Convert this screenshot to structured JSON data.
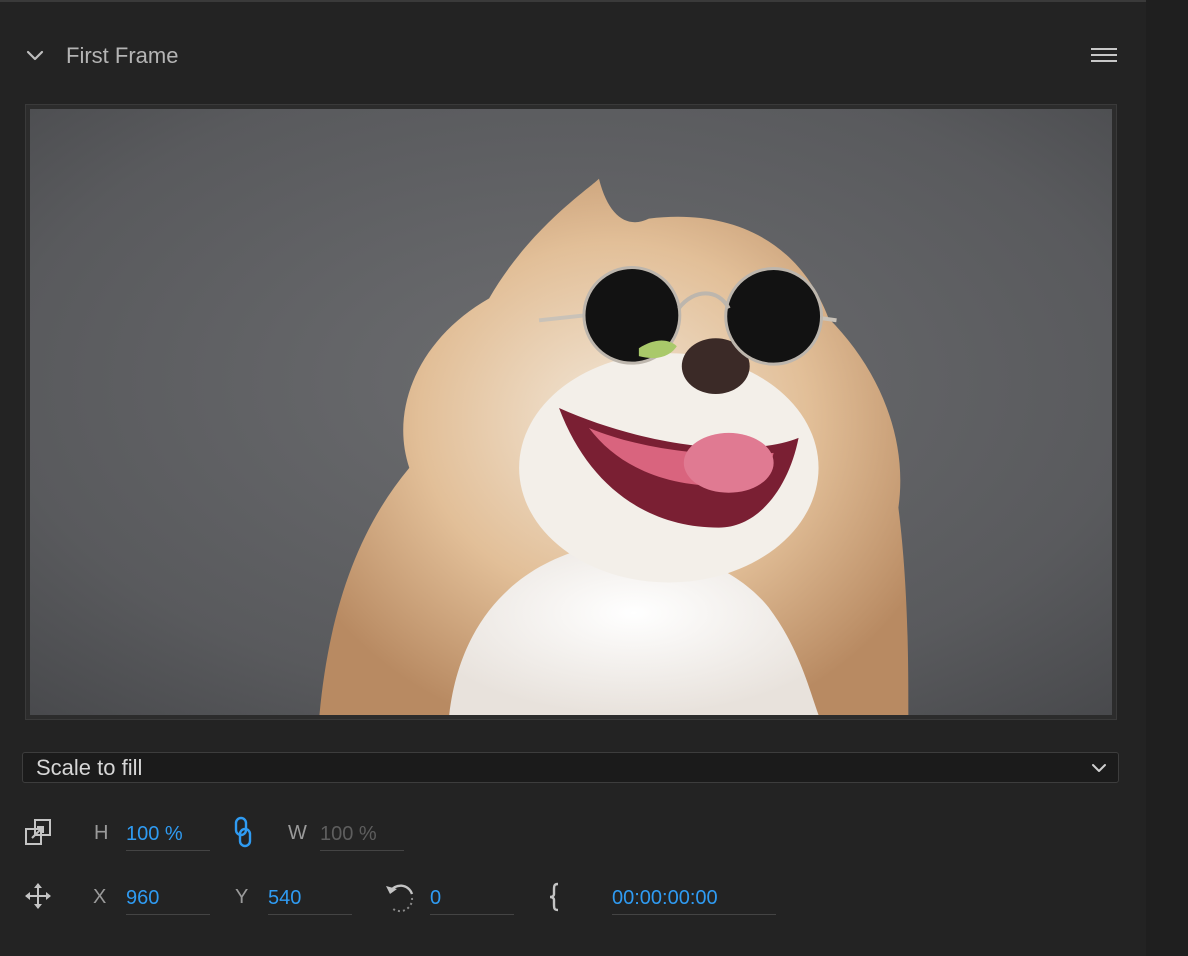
{
  "panel": {
    "title": "First Frame"
  },
  "icons": {
    "collapse": "chevron-down-icon",
    "menu": "hamburger-menu-icon",
    "scale": "scale-icon",
    "link": "link-icon",
    "position": "move-icon",
    "rotation": "rotate-icon",
    "time": "time-bracket-icon"
  },
  "dropdown": {
    "selected": "Scale to fill"
  },
  "scale_row": {
    "h_label": "H",
    "h_value": "100 %",
    "w_label": "W",
    "w_value": "100 %"
  },
  "position_row": {
    "x_label": "X",
    "x_value": "960",
    "y_label": "Y",
    "y_value": "540",
    "rotation_value": "0",
    "timecode": "00:00:00:00"
  },
  "colors": {
    "accent": "#2f9bf2",
    "background": "#232323",
    "label": "#9a9a9a"
  }
}
